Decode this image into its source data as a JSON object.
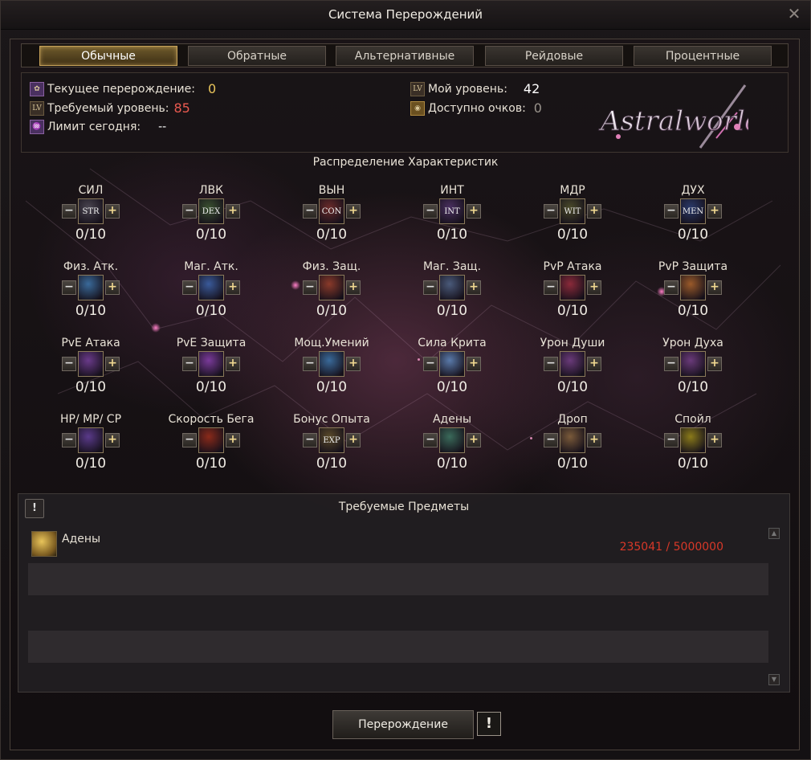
{
  "window": {
    "title": "Система Перерождений"
  },
  "tabs": [
    {
      "label": "Обычные",
      "active": true
    },
    {
      "label": "Обратные",
      "active": false
    },
    {
      "label": "Альтернативные",
      "active": false
    },
    {
      "label": "Рейдовые",
      "active": false
    },
    {
      "label": "Процентные",
      "active": false
    }
  ],
  "info": {
    "current_rebirth_label": "Текущее перерождение:",
    "current_rebirth_value": "0",
    "required_level_label": "Требуемый уровень:",
    "required_level_value": "85",
    "limit_today_label": "Лимит сегодня:",
    "limit_today_value": "--",
    "my_level_label": "Мой уровень:",
    "my_level_value": "42",
    "points_available_label": "Доступно очков:",
    "points_available_value": "0",
    "lv_badge": "LV",
    "logo_text": "Astralworld"
  },
  "stats_section_title": "Распределение Характеристик",
  "stats": [
    [
      {
        "label": "СИЛ",
        "icon": "STR",
        "icon_name": "str-icon",
        "color": "#4a4550",
        "value": "0/10"
      },
      {
        "label": "ЛВК",
        "icon": "DEX",
        "icon_name": "dex-icon",
        "color": "#3a5030",
        "value": "0/10"
      },
      {
        "label": "ВЫН",
        "icon": "CON",
        "icon_name": "con-icon",
        "color": "#6a2a2a",
        "value": "0/10"
      },
      {
        "label": "ИНТ",
        "icon": "INT",
        "icon_name": "int-icon",
        "color": "#4a3060",
        "value": "0/10"
      },
      {
        "label": "МДР",
        "icon": "WIT",
        "icon_name": "wit-icon",
        "color": "#4a4a2a",
        "value": "0/10"
      },
      {
        "label": "ДУХ",
        "icon": "MEN",
        "icon_name": "men-icon",
        "color": "#2a3a6a",
        "value": "0/10"
      }
    ],
    [
      {
        "label": "Физ. Атк.",
        "icon": "",
        "icon_name": "sword-icon",
        "color": "#3a6a9a",
        "value": "0/10"
      },
      {
        "label": "Маг. Атк.",
        "icon": "",
        "icon_name": "magic-attack-icon",
        "color": "#3a5a9a",
        "value": "0/10"
      },
      {
        "label": "Физ. Защ.",
        "icon": "",
        "icon_name": "shield-hammer-icon",
        "color": "#8a3a2a",
        "value": "0/10"
      },
      {
        "label": "Маг. Защ.",
        "icon": "",
        "icon_name": "magic-defense-icon",
        "color": "#4a5a7a",
        "value": "0/10"
      },
      {
        "label": "PvP Атака",
        "icon": "",
        "icon_name": "pvp-attack-icon",
        "color": "#8a2a3a",
        "value": "0/10"
      },
      {
        "label": "PvP Защита",
        "icon": "",
        "icon_name": "pvp-defense-icon",
        "color": "#9a5a2a",
        "value": "0/10"
      }
    ],
    [
      {
        "label": "PvE Атака",
        "icon": "",
        "icon_name": "pve-attack-icon",
        "color": "#6a3a8a",
        "value": "0/10"
      },
      {
        "label": "PvE Защита",
        "icon": "",
        "icon_name": "pve-defense-icon",
        "color": "#7a3a9a",
        "value": "0/10"
      },
      {
        "label": "Мощ.Умений",
        "icon": "",
        "icon_name": "skill-power-icon",
        "color": "#3a6a9a",
        "value": "0/10"
      },
      {
        "label": "Сила Крита",
        "icon": "",
        "icon_name": "crit-power-icon",
        "color": "#5a7aaa",
        "value": "0/10"
      },
      {
        "label": "Урон Души",
        "icon": "",
        "icon_name": "soul-damage-icon",
        "color": "#6a3a7a",
        "value": "0/10"
      },
      {
        "label": "Урон Духа",
        "icon": "",
        "icon_name": "spirit-damage-icon",
        "color": "#6a3a7a",
        "value": "0/10"
      }
    ],
    [
      {
        "label": "HP/ MP/ CP",
        "icon": "",
        "icon_name": "hp-mp-cp-icon",
        "color": "#5a3a8a",
        "value": "0/10"
      },
      {
        "label": "Скорость Бега",
        "icon": "",
        "icon_name": "run-speed-icon",
        "color": "#8a2a1a",
        "value": "0/10"
      },
      {
        "label": "Бонус Опыта",
        "icon": "EXP",
        "icon_name": "exp-icon",
        "color": "#5a4a2a",
        "value": "0/10"
      },
      {
        "label": "Адены",
        "icon": "",
        "icon_name": "adena-icon",
        "color": "#3a6a5a",
        "value": "0/10"
      },
      {
        "label": "Дроп",
        "icon": "",
        "icon_name": "drop-icon",
        "color": "#7a5a3a",
        "value": "0/10"
      },
      {
        "label": "Спойл",
        "icon": "",
        "icon_name": "spoil-icon",
        "color": "#8a7a1a",
        "value": "0/10"
      }
    ]
  ],
  "required_items": {
    "title": "Требуемые Предметы",
    "items": [
      {
        "name": "Адены",
        "count": "235041 / 5000000"
      }
    ]
  },
  "rebirth_button": "Перерождение",
  "warn_symbol": "!"
}
